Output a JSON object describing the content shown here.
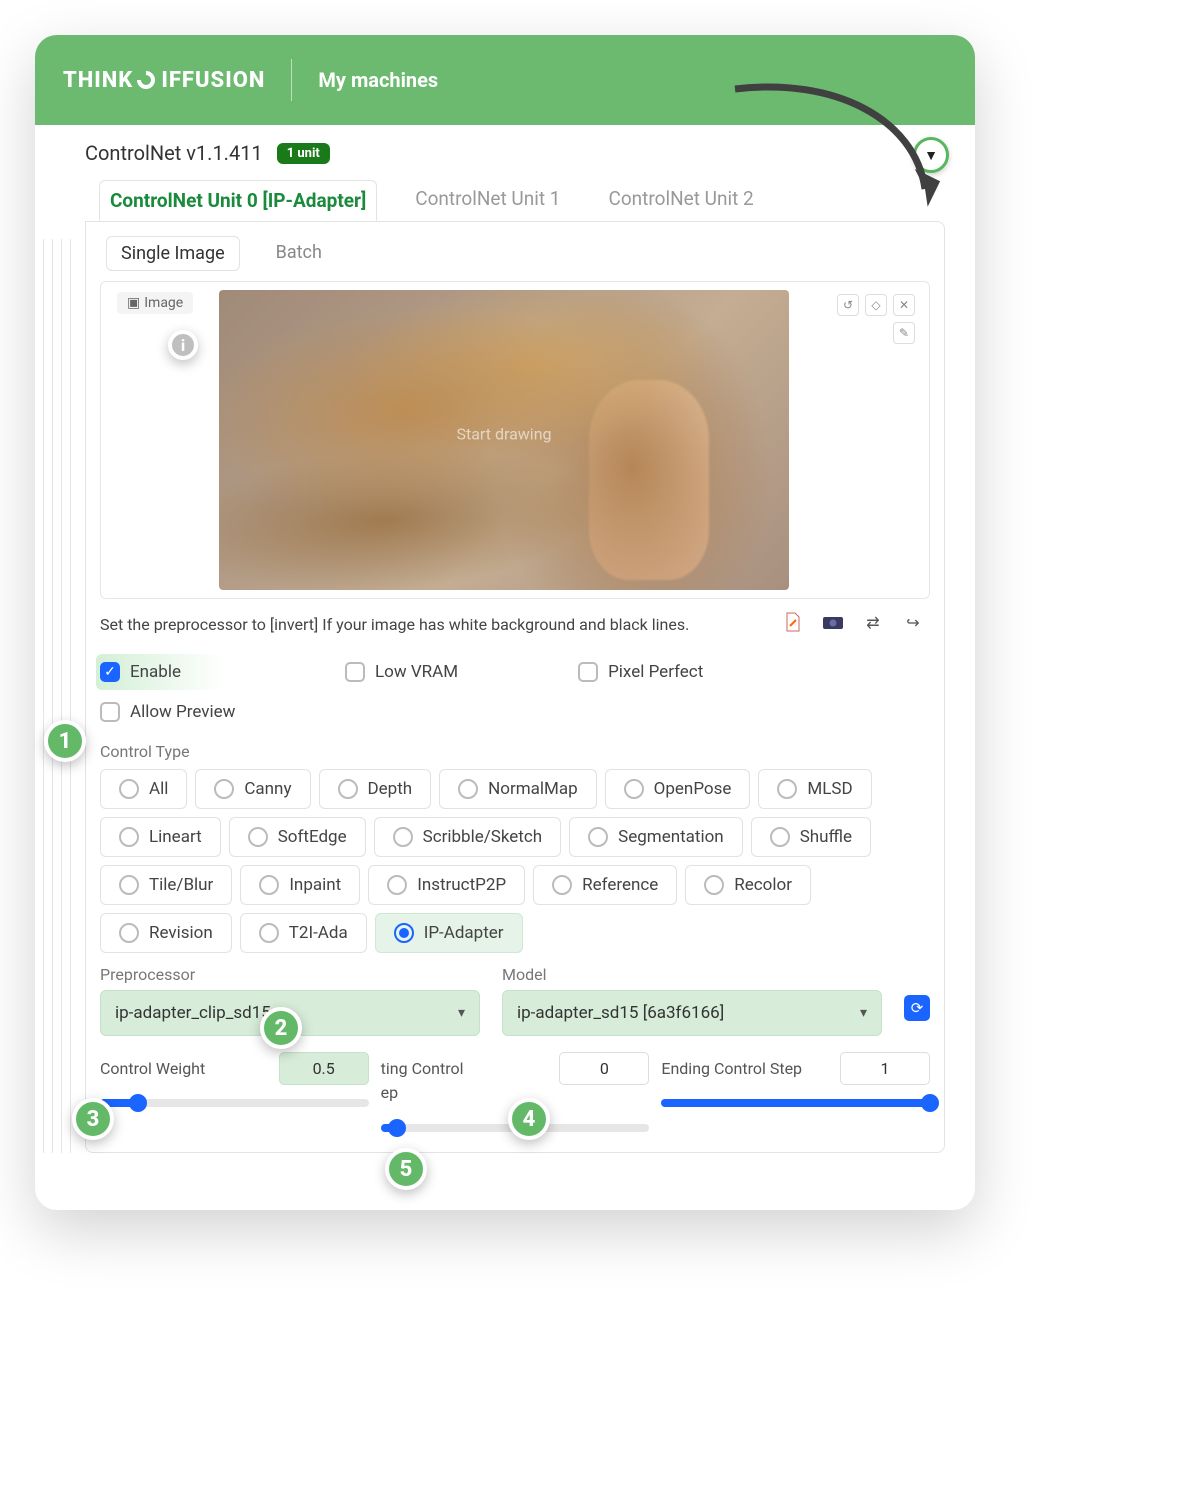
{
  "header": {
    "logo_left": "THINK",
    "logo_right": "IFFUSION",
    "nav": "My machines"
  },
  "title": "ControlNet v1.1.411",
  "unit_badge": "1 unit",
  "tabs": [
    "ControlNet Unit 0 [IP-Adapter]",
    "ControlNet Unit 1",
    "ControlNet Unit 2"
  ],
  "subtabs": [
    "Single Image",
    "Batch"
  ],
  "image_label": "Image",
  "draw_text": "Start drawing",
  "hint": "Set the preprocessor to [invert] If your image has white background and black lines.",
  "checks": {
    "enable": "Enable",
    "lowvram": "Low VRAM",
    "pixel": "Pixel Perfect",
    "preview": "Allow Preview"
  },
  "control_type_label": "Control Type",
  "control_types": [
    "All",
    "Canny",
    "Depth",
    "NormalMap",
    "OpenPose",
    "MLSD",
    "Lineart",
    "SoftEdge",
    "Scribble/Sketch",
    "Segmentation",
    "Shuffle",
    "Tile/Blur",
    "Inpaint",
    "InstructP2P",
    "Reference",
    "Recolor",
    "Revision",
    "T2I-Ada",
    "IP-Adapter"
  ],
  "selected_control_type": "IP-Adapter",
  "preprocessor_label": "Preprocessor",
  "preprocessor_value": "ip-adapter_clip_sd15",
  "model_label": "Model",
  "model_value": "ip-adapter_sd15 [6a3f6166]",
  "sliders": {
    "weight_label": "Control Weight",
    "weight_value": "0.5",
    "start_label_a": "ting Control",
    "start_label_b": "ep",
    "start_value": "0",
    "end_label": "Ending Control Step",
    "end_value": "1"
  },
  "callouts": {
    "c1": "1",
    "c2": "2",
    "c3": "3",
    "c4": "4",
    "c5": "5"
  }
}
